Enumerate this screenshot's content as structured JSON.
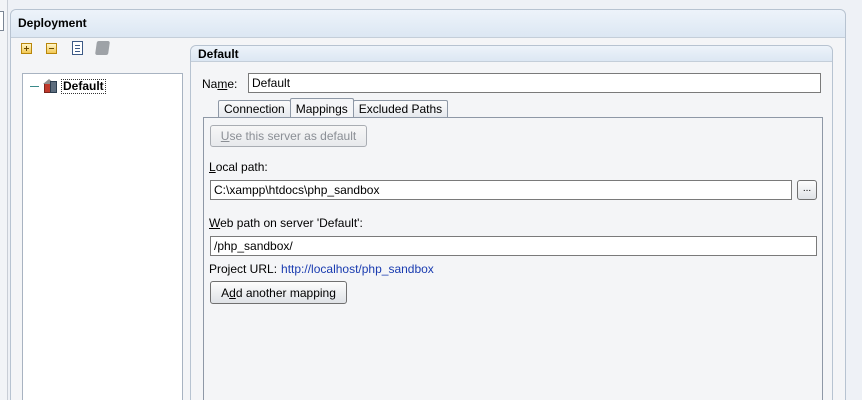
{
  "window": {
    "title": "Deployment"
  },
  "toolbar": {
    "icons": [
      "add-icon",
      "remove-icon",
      "copy-icon",
      "disabled-server-icon"
    ]
  },
  "tree": {
    "items": [
      {
        "label": "Default",
        "icon": "server-icon"
      }
    ]
  },
  "detail": {
    "title": "Default",
    "name_label_pre": "Na",
    "name_label_mnemonic": "m",
    "name_label_post": "e:",
    "name_value": "Default",
    "tabs": [
      "Connection",
      "Mappings",
      "Excluded Paths"
    ],
    "active_tab": "Mappings"
  },
  "mappings": {
    "use_server_mnemonic": "U",
    "use_server_rest": "se this server as default",
    "local_path_mnemonic": "L",
    "local_path_rest": "ocal path:",
    "local_path_value": "C:\\xampp\\htdocs\\php_sandbox",
    "browse_label": "...",
    "web_path_mnemonic": "W",
    "web_path_rest": "eb path on server 'Default':",
    "web_path_value": "/php_sandbox/",
    "project_url_label": "Project URL:",
    "project_url_value": "http://localhost/php_sandbox",
    "add_mapping_pre": "A",
    "add_mapping_mnemonic": "d",
    "add_mapping_post": "d another mapping"
  },
  "colors": {
    "link": "#1a3cb0",
    "header_bg": "#dce7f3",
    "border": "#b7c3d1"
  }
}
